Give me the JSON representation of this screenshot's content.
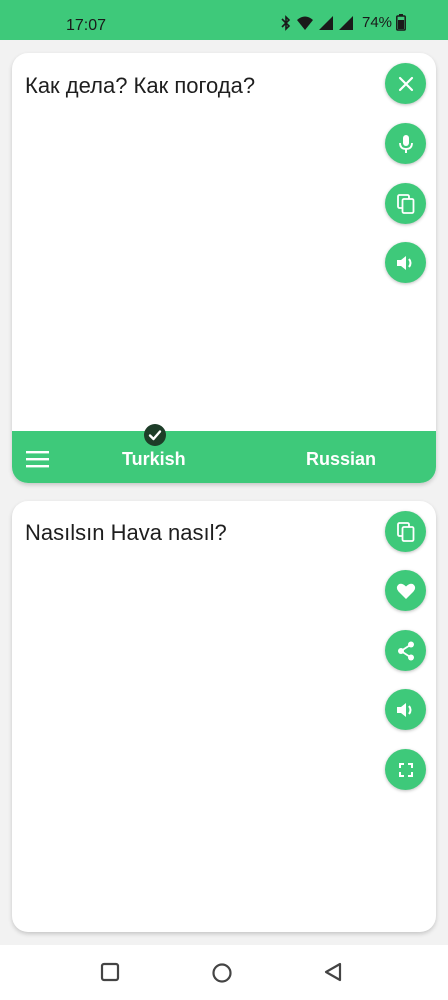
{
  "status_bar": {
    "time": "17:07",
    "battery": "74%"
  },
  "source_card": {
    "text": "Как дела? Как погода?",
    "buttons": [
      "close-icon",
      "microphone-icon",
      "copy-icon",
      "volume-icon"
    ]
  },
  "language_bar": {
    "source_language": "Turkish",
    "target_language": "Russian"
  },
  "result_card": {
    "text": "Nasılsın Hava nasıl?",
    "buttons": [
      "copy-icon",
      "heart-icon",
      "share-icon",
      "volume-icon",
      "fullscreen-icon"
    ]
  },
  "colors": {
    "accent": "#3ec97a",
    "badge": "#1d3d28"
  }
}
